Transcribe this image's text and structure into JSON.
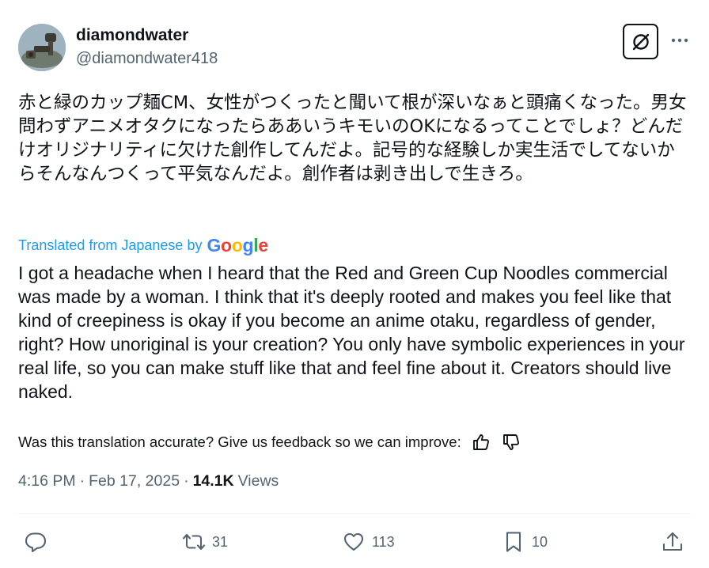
{
  "user": {
    "display_name": "diamondwater",
    "handle": "@diamondwater418"
  },
  "post": {
    "original_text": "赤と緑のカップ麺CM、女性がつくったと聞いて根が深いなぁと頭痛くなった。男女問わずアニメオタクになったらああいうキモいのOKになるってことでしょ？どんだけオリジナリティに欠けた創作してんだよ。記号的な経験しか実生活でしてないからそんなんつくって平気なんだよ。創作者は剥き出しで生きろ。",
    "translated_label": "Translated from Japanese by",
    "translation_provider": "Google",
    "translated_text": "I got a headache when I heard that the Red and Green Cup Noodles commercial was made by a woman. I think that it's deeply rooted and makes you feel like that kind of creepiness is okay if you become an anime otaku, regardless of gender, right? How unoriginal is your creation? You only have symbolic experiences in your real life, so you can make stuff like that and feel fine about it. Creators should live naked.",
    "feedback_prompt": "Was this translation accurate? Give us feedback so we can improve:"
  },
  "meta": {
    "time": "4:16 PM",
    "date": "Feb 17, 2025",
    "views_count": "14.1K",
    "views_label": "Views"
  },
  "actions": {
    "replies": "",
    "reposts": "31",
    "likes": "113",
    "bookmarks": "10"
  },
  "icons": {
    "grok": "grok-icon",
    "more": "more-icon",
    "thumbs_up": "thumbs-up-icon",
    "thumbs_down": "thumbs-down-icon",
    "reply": "reply-icon",
    "repost": "repost-icon",
    "like": "like-icon",
    "bookmark": "bookmark-icon",
    "share": "share-icon"
  },
  "colors": {
    "text": "#0f1419",
    "secondary": "#536471",
    "link": "#1d9bf0",
    "divider": "#eff3f4"
  }
}
